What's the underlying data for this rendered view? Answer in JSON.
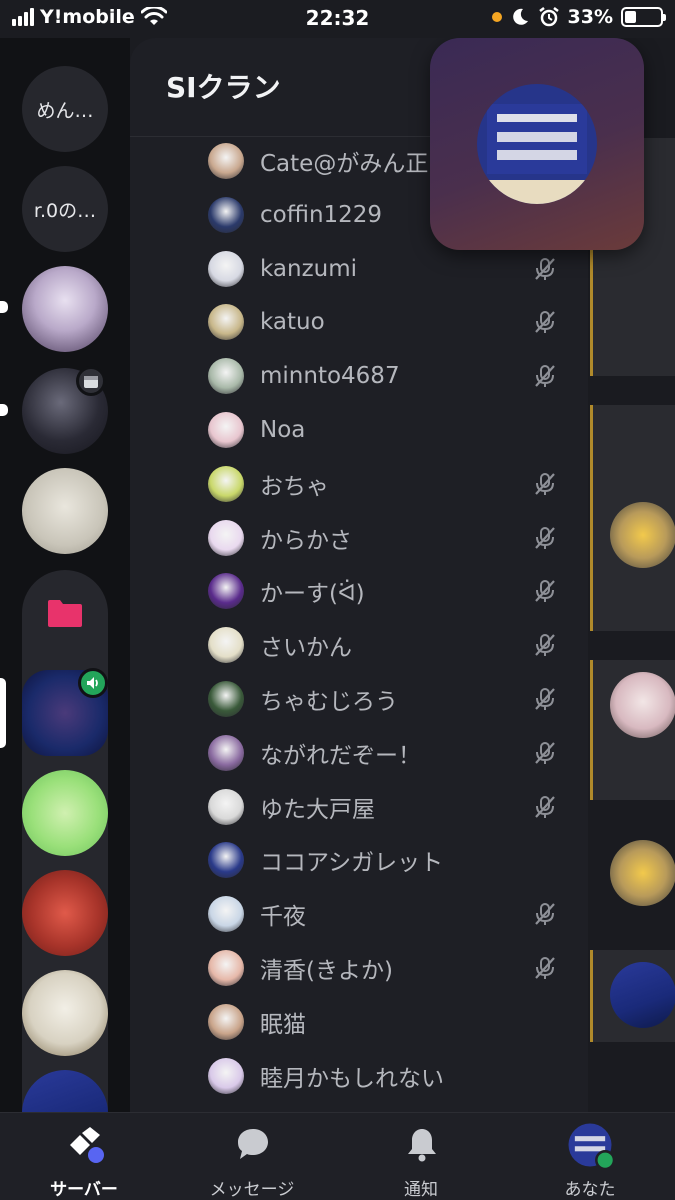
{
  "status_bar": {
    "carrier": "Y!mobile",
    "time": "22:32",
    "battery": "33%",
    "battery_level": 0.33
  },
  "rail": {
    "server_1": "めん…",
    "server_2": "r.0の…"
  },
  "panel": {
    "title": "SIクラン"
  },
  "members": [
    {
      "name": "Cate@がみん正",
      "muted": false,
      "color": "#c9a88f"
    },
    {
      "name": "coffin1229",
      "muted": false,
      "color": "#2b3a6b"
    },
    {
      "name": "kanzumi",
      "muted": true,
      "color": "#d7d9e3"
    },
    {
      "name": "katuo",
      "muted": true,
      "color": "#c8b78a"
    },
    {
      "name": "minnto4687",
      "muted": true,
      "color": "#a9b9a9"
    },
    {
      "name": "Noa",
      "muted": false,
      "color": "#e8c6cf"
    },
    {
      "name": "おちゃ",
      "muted": true,
      "color": "#c9d86a"
    },
    {
      "name": "からかさ",
      "muted": true,
      "color": "#e9d9ef"
    },
    {
      "name": "かーす(ᐛ)",
      "muted": true,
      "color": "#5a2b8c"
    },
    {
      "name": "さいかん",
      "muted": true,
      "color": "#e4dfc8"
    },
    {
      "name": "ちゃむじろう",
      "muted": true,
      "color": "#3a5a3a"
    },
    {
      "name": "ながれだぞー！",
      "muted": true,
      "color": "#8a6aa0"
    },
    {
      "name": "ゆた大戸屋",
      "muted": true,
      "color": "#d9d9d9"
    },
    {
      "name": "ココアシガレット",
      "muted": false,
      "color": "#2a3a8a"
    },
    {
      "name": "千夜",
      "muted": true,
      "color": "#c9d6e6"
    },
    {
      "name": "清香(きよか)",
      "muted": true,
      "color": "#e6b8a9"
    },
    {
      "name": "眠猫",
      "muted": false,
      "color": "#c9a48a"
    },
    {
      "name": "睦月かもしれない",
      "muted": false,
      "color": "#d9c9e9"
    }
  ],
  "bottom_nav": {
    "servers": "サーバー",
    "messages": "メッセージ",
    "notifications": "通知",
    "you": "あなた"
  },
  "icons": {
    "muted": "mic-muted-icon",
    "folder": "folder-icon",
    "calendar": "calendar-icon",
    "speaker": "speaker-icon",
    "wifi": "wifi-icon",
    "moon": "moon-icon",
    "alarm": "alarm-icon"
  },
  "colors": {
    "accent_blurple": "#5865f2",
    "online_green": "#23a55a",
    "folder_pink": "#e8336b",
    "divider_gold": "#b08a2b"
  }
}
